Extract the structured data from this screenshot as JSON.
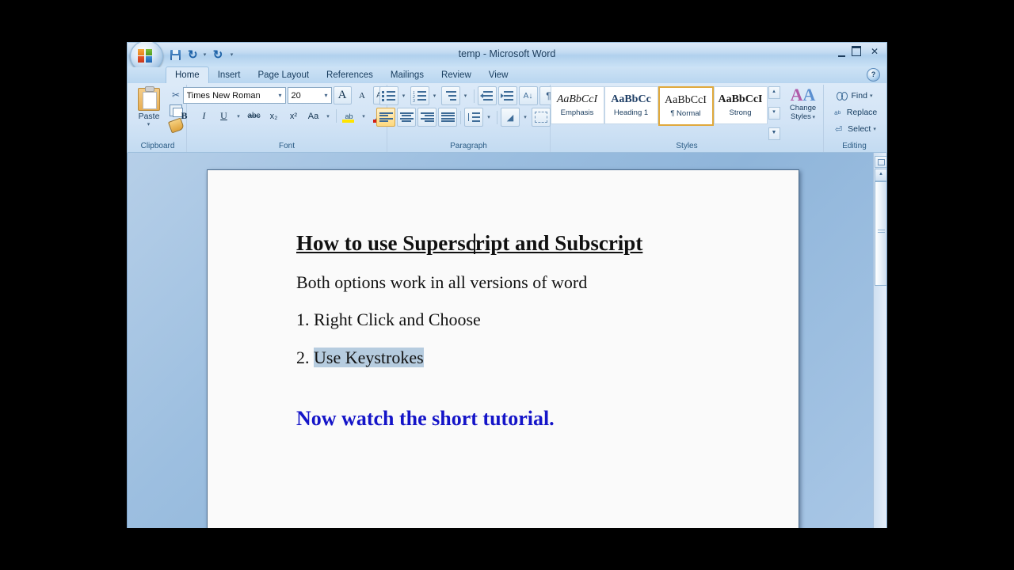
{
  "window": {
    "title": "temp - Microsoft Word",
    "controls": {
      "minimize": "–",
      "maximize": "□",
      "close": "✕",
      "help": "?"
    }
  },
  "quick_access": {
    "office_button": "office-orb",
    "items": [
      {
        "name": "save",
        "icon": "floppy-disk-icon"
      },
      {
        "name": "undo",
        "icon": "undo-arrow-icon",
        "caret": "▾"
      },
      {
        "name": "redo",
        "icon": "redo-arrow-icon"
      },
      {
        "name": "customize",
        "icon": "customize-caret-icon",
        "caret": "▾"
      }
    ]
  },
  "tabs": [
    {
      "label": "Home",
      "active": true
    },
    {
      "label": "Insert",
      "active": false
    },
    {
      "label": "Page Layout",
      "active": false
    },
    {
      "label": "References",
      "active": false
    },
    {
      "label": "Mailings",
      "active": false
    },
    {
      "label": "Review",
      "active": false
    },
    {
      "label": "View",
      "active": false
    }
  ],
  "ribbon": {
    "clipboard": {
      "label": "Clipboard",
      "paste_label": "Paste",
      "paste_caret": "▾",
      "cut_icon": "scissors-icon",
      "copy_icon": "copy-icon",
      "format_painter_icon": "paintbrush-icon"
    },
    "font": {
      "label": "Font",
      "font_name": "Times New Roman",
      "font_size": "20",
      "caret": "▾",
      "grow_font": "A",
      "shrink_font": "A",
      "clear_formatting": "clear-formatting-icon",
      "bold": "B",
      "italic": "I",
      "underline": "U",
      "strikethrough": "abc",
      "subscript": "x₂",
      "superscript": "x²",
      "change_case": "Aa",
      "highlight": "highlight-color-icon",
      "font_color": "A"
    },
    "paragraph": {
      "label": "Paragraph",
      "bullets": "bullet-list-icon",
      "numbering": "numbered-list-icon",
      "multilevel": "multilevel-list-icon",
      "decrease_indent": "decrease-indent-icon",
      "increase_indent": "increase-indent-icon",
      "sort": "sort-az-icon",
      "show_marks": "¶",
      "align_left": "align-left-icon",
      "align_center": "align-center-icon",
      "align_right": "align-right-icon",
      "justify": "justify-icon",
      "line_spacing": "line-spacing-icon",
      "shading": "shading-icon",
      "borders": "borders-icon"
    },
    "styles": {
      "label": "Styles",
      "gallery": [
        {
          "preview": "AaBbCcI",
          "name": "Emphasis",
          "selected": false,
          "kind": "em"
        },
        {
          "preview": "AaBbCс",
          "name": "Heading 1",
          "selected": false,
          "kind": "h1"
        },
        {
          "preview": "AaBbCcI",
          "name": "¶ Normal",
          "selected": true,
          "kind": "n"
        },
        {
          "preview": "AaBbCcI",
          "name": "Strong",
          "selected": false,
          "kind": "st"
        }
      ],
      "scroll_up": "▴",
      "scroll_down": "▾",
      "more": "▾",
      "change_styles_label_1": "Change",
      "change_styles_label_2": "Styles",
      "change_styles_caret": "▾"
    },
    "editing": {
      "label": "Editing",
      "items": [
        {
          "label": "Find",
          "icon": "binoculars-icon",
          "caret": "▾"
        },
        {
          "label": "Replace",
          "icon": "replace-icon",
          "caret": ""
        },
        {
          "label": "Select",
          "icon": "select-pointer-icon",
          "caret": "▾"
        }
      ]
    }
  },
  "document": {
    "heading": "How to use Superscript and Subscript",
    "paragraph": "Both options work in all versions of word",
    "items": [
      {
        "number": "1.",
        "text": "Right Click and Choose",
        "selected": false
      },
      {
        "number": "2.",
        "text": "Use Keystrokes",
        "selected": true
      }
    ],
    "closing": "Now watch the short tutorial.",
    "selection_color": "#b6ccdf",
    "closing_color": "#1414c8"
  },
  "scrollbar": {
    "select_object": "select-browse-object-icon",
    "up_arrow": "▴"
  }
}
